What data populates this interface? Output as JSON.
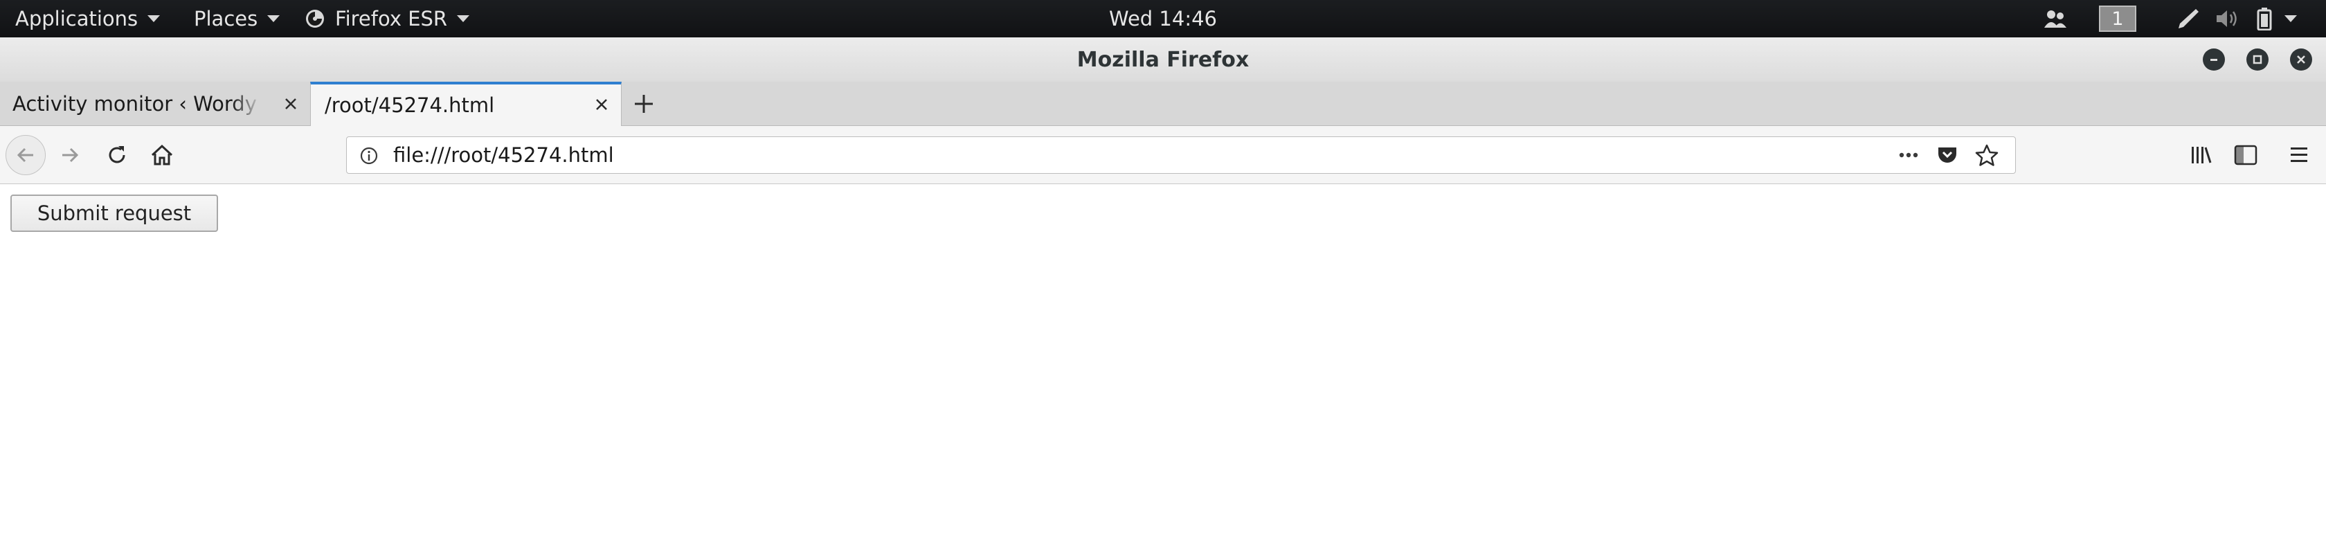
{
  "topbar": {
    "applications": "Applications",
    "places": "Places",
    "firefox": "Firefox ESR",
    "clock": "Wed 14:46",
    "workspace": "1"
  },
  "window": {
    "title": "Mozilla Firefox"
  },
  "tabs": [
    {
      "label": "Activity monitor ‹ Wordy — WordPress",
      "active": false
    },
    {
      "label": "/root/45274.html",
      "active": true
    }
  ],
  "navbar": {
    "url": "file:///root/45274.html"
  },
  "page": {
    "submit_label": "Submit request"
  },
  "colors": {
    "accent": "#2f7fd0",
    "topbar": "#16181a"
  },
  "icons": [
    "firefox-icon",
    "users-icon",
    "pen-icon",
    "volume-icon",
    "battery-icon",
    "minimize-icon",
    "maximize-icon",
    "close-icon",
    "back-icon",
    "forward-icon",
    "reload-icon",
    "home-icon",
    "info-icon",
    "more-icon",
    "pocket-icon",
    "star-icon",
    "library-icon",
    "sidebar-icon",
    "menu-icon"
  ]
}
